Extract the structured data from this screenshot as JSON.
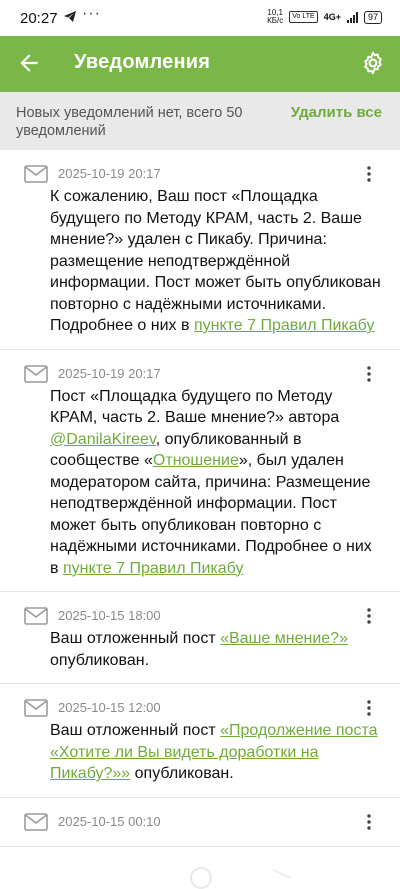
{
  "status_bar": {
    "time": "20:27",
    "speed_top": "10,1",
    "speed_bottom": "КБ/с",
    "vo_label": "Vo LTE",
    "net_label": "4G+",
    "battery": "97"
  },
  "app_bar": {
    "title": "Уведомления",
    "back_icon": "arrow-left-icon",
    "settings_icon": "gear-icon"
  },
  "info_bar": {
    "summary": "Новых уведомлений нет, всего 50 уведомлений",
    "delete_all": "Удалить все"
  },
  "colors": {
    "primary": "#7ab648",
    "link": "#6fab3c",
    "info_bg": "#e9e9e9",
    "date": "#8a8a8a"
  },
  "notifications": [
    {
      "date": "2025-10-19 20:17",
      "segments": [
        {
          "t": "К сожалению, Ваш пост «Площадка будущего по Методу КРАМ, часть 2. Ваше мнение?» удален с Пикабу. Причина: размещение неподтверждённой информации. Пост может быть опубликован повторно с надёжными источниками. Подробнее о них в "
        },
        {
          "t": "пункте 7 Правил Пикабу",
          "link": true
        }
      ]
    },
    {
      "date": "2025-10-19 20:17",
      "segments": [
        {
          "t": "Пост «Площадка будущего по Методу КРАМ, часть 2. Ваше мнение?» автора "
        },
        {
          "t": "@DanilaKireev",
          "link": true
        },
        {
          "t": ", опубликованный в сообществе «"
        },
        {
          "t": "Отношение",
          "link": true
        },
        {
          "t": "», был удален модератором сайта, причина: Размещение неподтверждённой информации. Пост может быть опубликован повторно с надёжными источниками. Подробнее о них в "
        },
        {
          "t": "пункте 7 Правил Пикабу",
          "link": true
        }
      ]
    },
    {
      "date": "2025-10-15 18:00",
      "segments": [
        {
          "t": "Ваш отложенный пост "
        },
        {
          "t": "«Ваше мнение?»",
          "link": true
        },
        {
          "t": " опубликован."
        }
      ]
    },
    {
      "date": "2025-10-15 12:00",
      "segments": [
        {
          "t": "Ваш отложенный пост "
        },
        {
          "t": "«Продолжение поста «Хотите ли Вы видеть доработки на Пикабу?»»",
          "link": true
        },
        {
          "t": " опубликован."
        }
      ]
    },
    {
      "date": "2025-10-15 00:10",
      "segments": []
    }
  ]
}
